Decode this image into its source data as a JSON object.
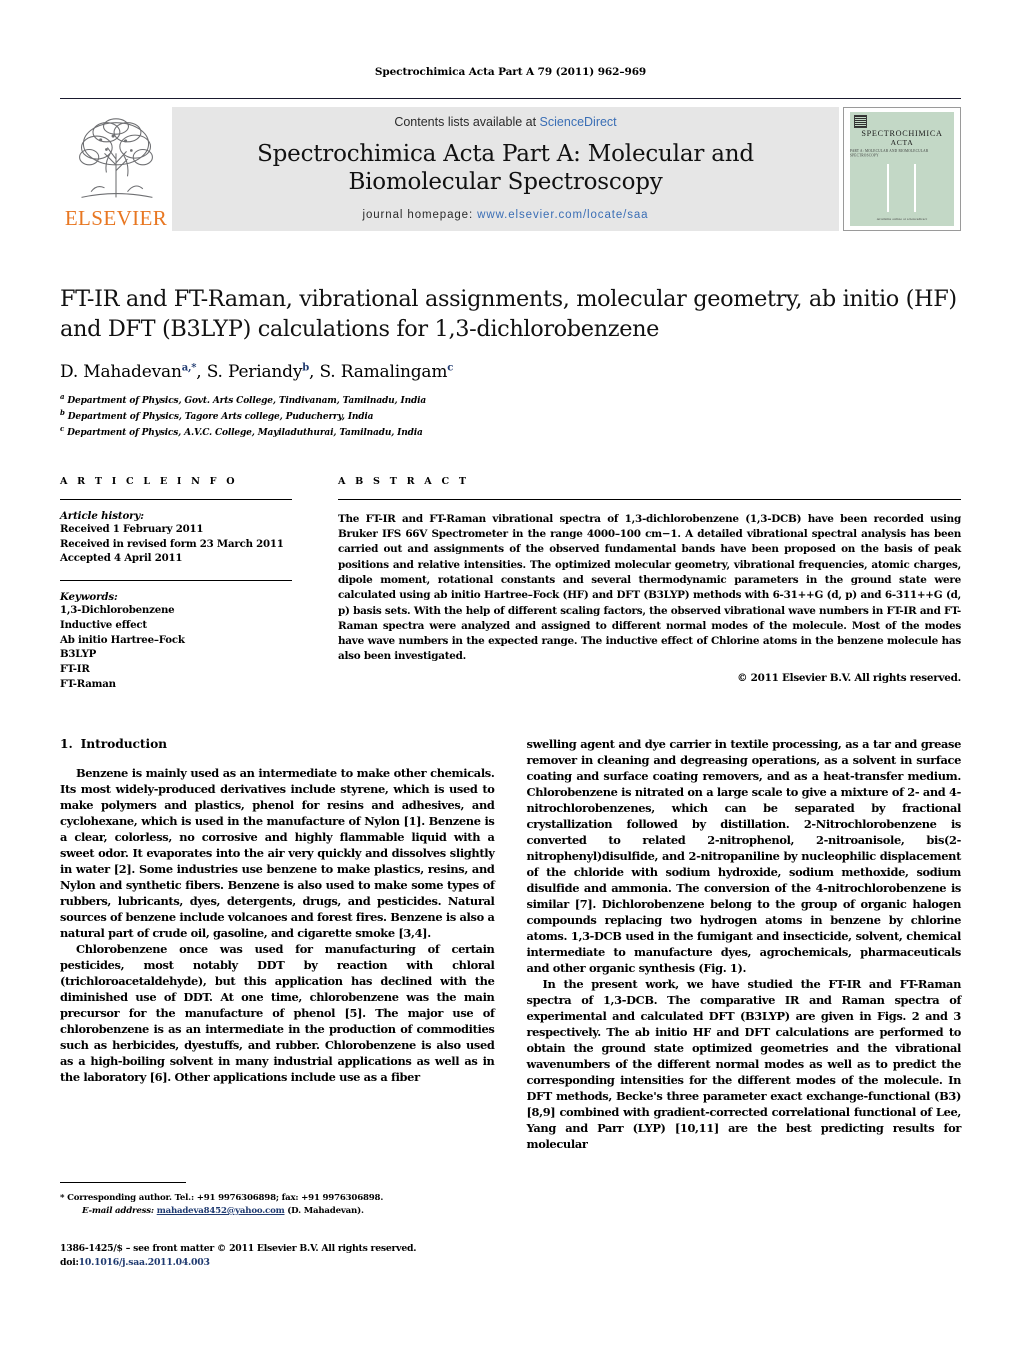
{
  "running_head": "Spectrochimica Acta Part A 79 (2011) 962–969",
  "masthead": {
    "publisher_logo_text": "ELSEVIER",
    "contents_prefix": "Contents lists available at ",
    "contents_link": "ScienceDirect",
    "journal_title_line1": "Spectrochimica Acta Part A: Molecular and",
    "journal_title_line2": "Biomolecular Spectroscopy",
    "homepage_label": "journal homepage:",
    "homepage_url": "www.elsevier.com/locate/saa",
    "cover": {
      "line1": "SPECTROCHIMICA",
      "line2": "ACTA",
      "line3": "PART A: MOLECULAR AND BIOMOLECULAR SPECTROSCOPY",
      "footer": "Available online at sciencedirect"
    }
  },
  "article": {
    "title": "FT-IR and FT-Raman, vibrational assignments, molecular geometry, ab initio (HF) and DFT (B3LYP) calculations for 1,3-dichlorobenzene",
    "authors": [
      {
        "name": "D. Mahadevan",
        "marks": "a,*"
      },
      {
        "name": "S. Periandy",
        "marks": "b"
      },
      {
        "name": "S. Ramalingam",
        "marks": "c"
      }
    ],
    "affiliations": [
      {
        "mark": "a",
        "text": "Department of Physics, Govt. Arts College, Tindivanam, Tamilnadu, India"
      },
      {
        "mark": "b",
        "text": "Department of Physics, Tagore Arts college, Puducherry, India"
      },
      {
        "mark": "c",
        "text": "Department of Physics, A.V.C. College, Mayiladuthurai, Tamilnadu, India"
      }
    ]
  },
  "article_info": {
    "heading": "A R T I C L E    I N F O",
    "history_label": "Article history:",
    "history": [
      "Received 1 February 2011",
      "Received in revised form 23 March 2011",
      "Accepted 4 April 2011"
    ],
    "keywords_label": "Keywords:",
    "keywords": [
      "1,3-Dichlorobenzene",
      "Inductive effect",
      "Ab initio Hartree–Fock",
      "B3LYP",
      "FT-IR",
      "FT-Raman"
    ]
  },
  "abstract": {
    "heading": "A B S T R A C T",
    "text": "The FT-IR and FT-Raman vibrational spectra of 1,3-dichlorobenzene (1,3-DCB) have been recorded using Bruker IFS 66V Spectrometer in the range 4000–100 cm−1. A detailed vibrational spectral analysis has been carried out and assignments of the observed fundamental bands have been proposed on the basis of peak positions and relative intensities. The optimized molecular geometry, vibrational frequencies, atomic charges, dipole moment, rotational constants and several thermodynamic parameters in the ground state were calculated using ab initio Hartree–Fock (HF) and DFT (B3LYP) methods with 6-31++G (d, p) and 6-311++G (d, p) basis sets. With the help of different scaling factors, the observed vibrational wave numbers in FT-IR and FT-Raman spectra were analyzed and assigned to different normal modes of the molecule. Most of the modes have wave numbers in the expected range. The inductive effect of Chlorine atoms in the benzene molecule has also been investigated.",
    "copyright": "© 2011 Elsevier B.V. All rights reserved."
  },
  "introduction": {
    "number": "1.",
    "title": "Introduction",
    "paragraphs_left": [
      "Benzene is mainly used as an intermediate to make other chemicals. Its most widely-produced derivatives include styrene, which is used to make polymers and plastics, phenol for resins and adhesives, and cyclohexane, which is used in the manufacture of Nylon [1]. Benzene is a clear, colorless, no corrosive and highly flammable liquid with a sweet odor. It evaporates into the air very quickly and dissolves slightly in water [2]. Some industries use benzene to make plastics, resins, and Nylon and synthetic fibers. Benzene is also used to make some types of rubbers, lubricants, dyes, detergents, drugs, and pesticides. Natural sources of benzene include volcanoes and forest fires. Benzene is also a natural part of crude oil, gasoline, and cigarette smoke [3,4].",
      "Chlorobenzene once was used for manufacturing of certain pesticides, most notably DDT by reaction with chloral (trichloroacetaldehyde), but this application has declined with the diminished use of DDT. At one time, chlorobenzene was the main precursor for the manufacture of phenol [5]. The major use of chlorobenzene is as an intermediate in the production of commodities such as herbicides, dyestuffs, and rubber. Chlorobenzene is also used as a high-boiling solvent in many industrial applications as well as in the laboratory [6]. Other applications include use as a fiber"
    ],
    "paragraphs_right": [
      "swelling agent and dye carrier in textile processing, as a tar and grease remover in cleaning and degreasing operations, as a solvent in surface coating and surface coating removers, and as a heat-transfer medium. Chlorobenzene is nitrated on a large scale to give a mixture of 2- and 4-nitrochlorobenzenes, which can be separated by fractional crystallization followed by distillation. 2-Nitrochlorobenzene is converted to related 2-nitrophenol, 2-nitroanisole, bis(2-nitrophenyl)disulfide, and 2-nitropaniline by nucleophilic displacement of the chloride with sodium hydroxide, sodium methoxide, sodium disulfide and ammonia. The conversion of the 4-nitrochlorobenzene is similar [7]. Dichlorobenzene belong to the group of organic halogen compounds replacing two hydrogen atoms in benzene by chlorine atoms. 1,3-DCB used in the fumigant and insecticide, solvent, chemical intermediate to manufacture dyes, agrochemicals, pharmaceuticals and other organic synthesis (Fig. 1).",
      "In the present work, we have studied the FT-IR and FT-Raman spectra of 1,3-DCB. The comparative IR and Raman spectra of experimental and calculated DFT (B3LYP) are given in Figs. 2 and 3 respectively. The ab initio HF and DFT calculations are performed to obtain the ground state optimized geometries and the vibrational wavenumbers of the different normal modes as well as to predict the corresponding intensities for the different modes of the molecule. In DFT methods, Becke's three parameter exact exchange-functional (B3) [8,9] combined with gradient-corrected correlational functional of Lee, Yang and Parr (LYP) [10,11] are the best predicting results for molecular"
    ]
  },
  "footer": {
    "corresponding": "* Corresponding author. Tel.: +91 9976306898; fax: +91 9976306898.",
    "email_label": "E-mail address:",
    "email": "mahadeva8452@yahoo.com",
    "email_owner": "(D. Mahadevan).",
    "issn_line": "1386-1425/$ – see front matter © 2011 Elsevier B.V. All rights reserved.",
    "doi_label": "doi:",
    "doi": "10.1016/j.saa.2011.04.003"
  },
  "colors": {
    "link": "#3a6eb5",
    "ref": "#1f3a70",
    "elsevier_orange": "#E87722",
    "band_gray": "#e6e6e6",
    "cover_green": "#c3d8c6"
  }
}
